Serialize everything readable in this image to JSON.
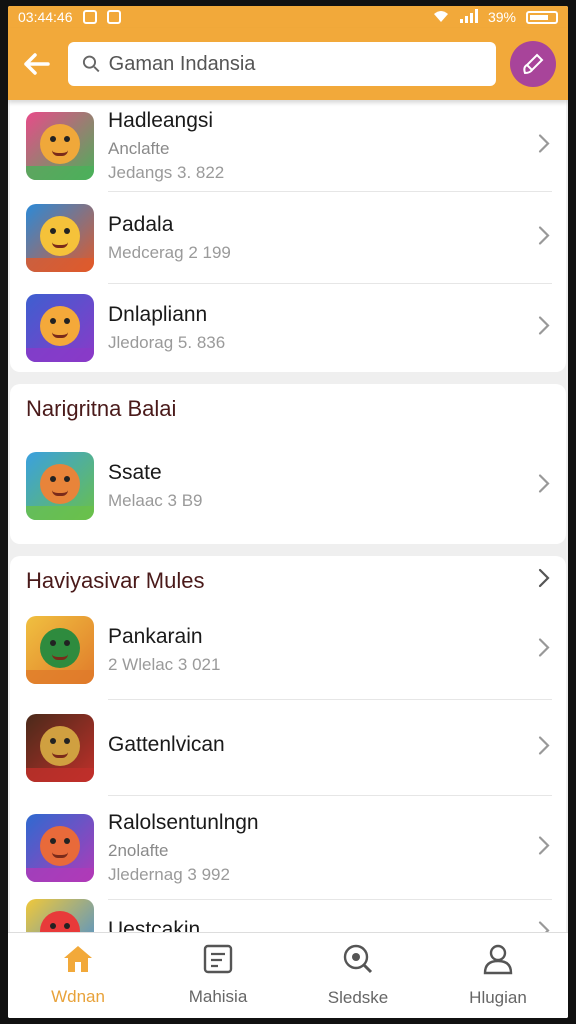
{
  "status_bar": {
    "time": "03:44:46",
    "battery": "39%"
  },
  "header": {
    "search_value": "Gaman Indansia"
  },
  "groups": [
    {
      "title": "",
      "items": [
        {
          "title": "Hadleangsi",
          "subtitle": "Anclafte",
          "meta": "Jedangs 3. 822",
          "colors": [
            "#e84b8a",
            "#f0a83a",
            "#4bb05a"
          ]
        },
        {
          "title": "Padala",
          "subtitle": "",
          "meta": "Medcerag 2 199",
          "colors": [
            "#2b8ad8",
            "#f5c23a",
            "#e05a2a"
          ]
        },
        {
          "title": "Dnlapliann",
          "subtitle": "",
          "meta": "Jledorag 5. 836",
          "colors": [
            "#3d5fd0",
            "#f4a93a",
            "#8a3ac8"
          ]
        }
      ]
    },
    {
      "title": "Narigritna Balai",
      "items": [
        {
          "title": "Ssate",
          "subtitle": "",
          "meta": "Melaac 3 B9",
          "colors": [
            "#3aa0e0",
            "#e8843a",
            "#6ac04a"
          ]
        }
      ]
    },
    {
      "title": "Haviyasivar Mules",
      "items": [
        {
          "title": "Pankarain",
          "subtitle": "",
          "meta": "2 Wlelac 3 021",
          "colors": [
            "#f0c040",
            "#2e8b3e",
            "#e07a2a"
          ]
        },
        {
          "title": "Gattenlvican",
          "subtitle": "",
          "meta": "",
          "colors": [
            "#4a2a1a",
            "#d0a040",
            "#c0302a"
          ]
        },
        {
          "title": "Ralolsentunlngn",
          "subtitle": "2nolafte",
          "meta": "Jledernag 3 992",
          "colors": [
            "#2e6ad0",
            "#e86a3a",
            "#b03ab8"
          ]
        },
        {
          "title": "Uestcakin",
          "subtitle": "",
          "meta": "",
          "colors": [
            "#f0c83a",
            "#e83a3a",
            "#3a8ae0"
          ]
        }
      ]
    }
  ],
  "tabs": [
    {
      "label": "Wdnan",
      "icon": "home-icon",
      "active": true
    },
    {
      "label": "Mahisia",
      "icon": "news-icon",
      "active": false
    },
    {
      "label": "Sledske",
      "icon": "search-icon",
      "active": false
    },
    {
      "label": "Hlugian",
      "icon": "user-icon",
      "active": false
    }
  ]
}
